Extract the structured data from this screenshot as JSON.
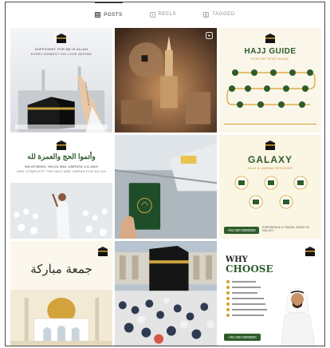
{
  "tabs": [
    {
      "label": "POSTS",
      "icon": "grid-icon",
      "active": true
    },
    {
      "label": "REELS",
      "icon": "reels-icon",
      "active": false
    },
    {
      "label": "TAGGED",
      "icon": "tagged-icon",
      "active": false
    }
  ],
  "posts": [
    {
      "line1": "SUFFICIENT FOR ME IS ALLAH",
      "line2": "EVERY MOMENT HIS LOVE BEHIND"
    },
    {
      "kind": "photo"
    },
    {
      "title": "HAJJ GUIDE",
      "subtitle": "STEP BY STEP GUIDE"
    },
    {
      "arabic": "وأتموا الحج والعمرة لله",
      "line1": "WA ATIMMUL HAJJA WAL UMRATA LILLAAH",
      "line2": "AND COMPLETE THE HAJJ AND UMRAH FOR ALLAH"
    },
    {
      "kind": "photo"
    },
    {
      "title": "GALAXY",
      "subtitle": "HAJJ & UMRAH SERVICES",
      "phone": "+92 000 0000000",
      "footer": "EXPERIENCE & TRAVEL AGENT IN GALAXY"
    },
    {
      "arabic": "جمعة مباركة"
    },
    {
      "kind": "photo"
    },
    {
      "title_a": "WHY",
      "title_b": "CHOOSE",
      "phone": "+92 000 0000000"
    }
  ],
  "colors": {
    "gold": "#d6a12b",
    "green": "#2d5c2a",
    "black": "#111111"
  }
}
